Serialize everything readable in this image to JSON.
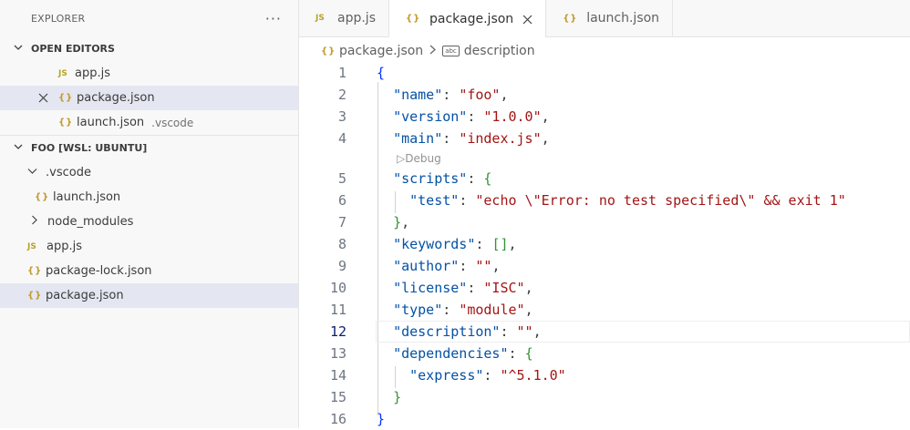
{
  "sidebar": {
    "title": "EXPLORER",
    "more_icon": "···",
    "open_editors": {
      "label": "OPEN EDITORS",
      "items": [
        {
          "icon": "JS",
          "label": "app.js",
          "desc": ""
        },
        {
          "icon": "{}",
          "label": "package.json",
          "desc": ""
        },
        {
          "icon": "{}",
          "label": "launch.json",
          "desc": ".vscode"
        }
      ]
    },
    "workspace": {
      "label": "FOO [WSL: UBUNTU]",
      "items": [
        {
          "icon": "",
          "label": ".vscode"
        },
        {
          "icon": "{}",
          "label": "launch.json"
        },
        {
          "icon": "",
          "label": "node_modules"
        },
        {
          "icon": "JS",
          "label": "app.js"
        },
        {
          "icon": "{}",
          "label": "package-lock.json"
        },
        {
          "icon": "{}",
          "label": "package.json"
        }
      ]
    }
  },
  "tabs": [
    {
      "icon": "JS",
      "label": "app.js"
    },
    {
      "icon": "{}",
      "label": "package.json"
    },
    {
      "icon": "{}",
      "label": "launch.json"
    }
  ],
  "breadcrumb": {
    "file": "package.json",
    "symbol_icon": "abc",
    "symbol": "description"
  },
  "editor": {
    "line_numbers": [
      "1",
      "2",
      "3",
      "4",
      "5",
      "6",
      "7",
      "8",
      "9",
      "10",
      "11",
      "12",
      "13",
      "14",
      "15",
      "16"
    ],
    "current_line": "12",
    "codelens": "Debug",
    "code": {
      "l1": "{",
      "l2_key": "\"name\"",
      "l2_val": "\"foo\"",
      "l3_key": "\"version\"",
      "l3_val": "\"1.0.0\"",
      "l4_key": "\"main\"",
      "l4_val": "\"index.js\"",
      "l5_key": "\"scripts\"",
      "l5_open": "{",
      "l6_key": "\"test\"",
      "l6_val": "\"echo \\\"Error: no test specified\\\" && exit 1\"",
      "l7_close": "}",
      "l8_key": "\"keywords\"",
      "l8_val": "[]",
      "l9_key": "\"author\"",
      "l9_val": "\"\"",
      "l10_key": "\"license\"",
      "l10_val": "\"ISC\"",
      "l11_key": "\"type\"",
      "l11_val": "\"module\"",
      "l12_key": "\"description\"",
      "l12_val": "\"\"",
      "l13_key": "\"dependencies\"",
      "l13_open": "{",
      "l14_key": "\"express\"",
      "l14_val": "\"^5.1.0\"",
      "l15_close": "}",
      "l16": "}"
    }
  }
}
